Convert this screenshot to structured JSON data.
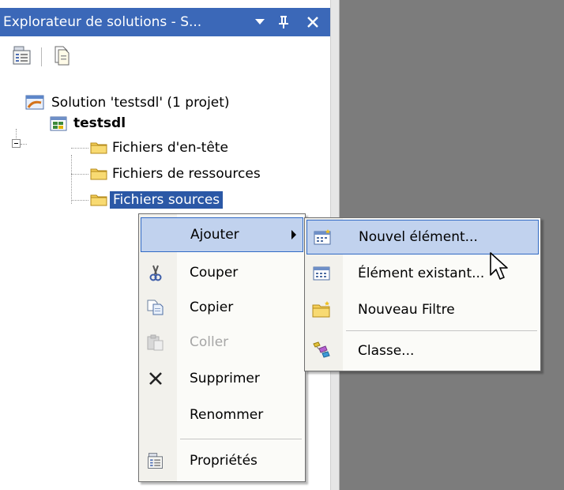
{
  "panel": {
    "title": "Explorateur de solutions - S...",
    "title_buttons": [
      "dropdown-arrow-icon",
      "pin-icon",
      "close-icon"
    ],
    "toolbar": [
      "properties-icon",
      "show-all-files-icon"
    ]
  },
  "tree": {
    "solution": "Solution 'testsdl' (1 projet)",
    "project": "testsdl",
    "folders": [
      "Fichiers d'en-tête",
      "Fichiers de ressources",
      "Fichiers sources"
    ]
  },
  "context_menu": {
    "items": [
      {
        "label": "Ajouter",
        "icon": "",
        "submenu": true
      },
      {
        "label": "Couper",
        "icon": "scissors-icon"
      },
      {
        "label": "Copier",
        "icon": "copy-icon"
      },
      {
        "label": "Coller",
        "icon": "paste-icon",
        "disabled": true
      },
      {
        "label": "Supprimer",
        "icon": "delete-x-icon"
      },
      {
        "label": "Renommer",
        "icon": ""
      },
      {
        "label": "Propriétés",
        "icon": "properties-icon"
      }
    ]
  },
  "submenu": {
    "items": [
      {
        "label": "Nouvel élément...",
        "icon": "new-item-icon"
      },
      {
        "label": "Élément existant...",
        "icon": "existing-item-icon"
      },
      {
        "label": "Nouveau Filtre",
        "icon": "new-folder-icon"
      },
      {
        "label": "Classe...",
        "icon": "class-icon"
      }
    ]
  },
  "colors": {
    "title_bar": "#3b68b8",
    "selection": "#2b58a6",
    "menu_highlight": "#c1d2ee",
    "menu_highlight_border": "#316ac5",
    "gray_area": "#7c7c7c"
  }
}
